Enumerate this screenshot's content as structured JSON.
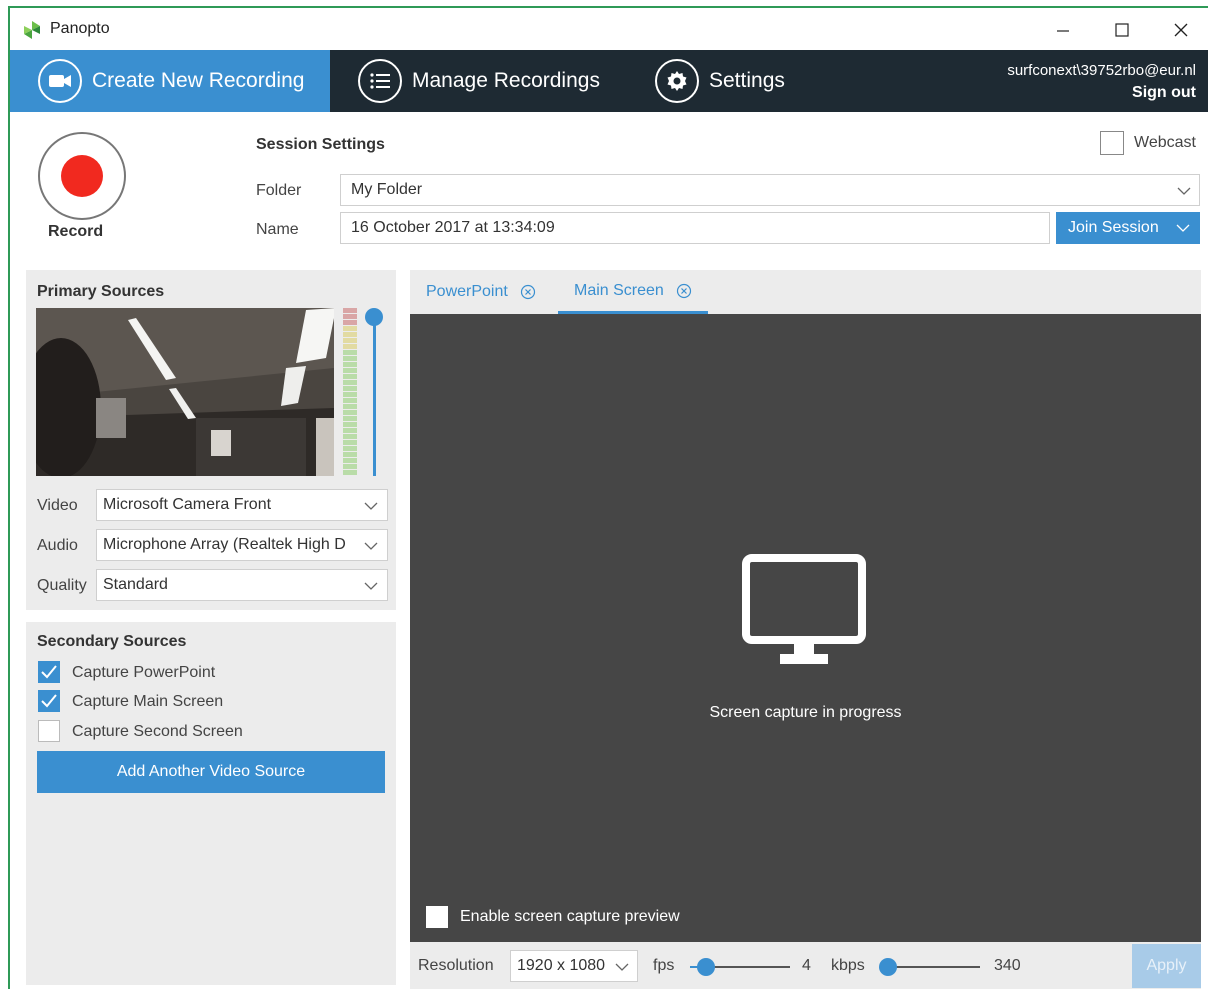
{
  "window": {
    "title": "Panopto",
    "minimize_icon": "minimize-icon",
    "maximize_icon": "maximize-icon",
    "close_icon": "close-icon"
  },
  "nav": {
    "tabs": [
      {
        "label": "Create New Recording",
        "icon": "camera-icon",
        "active": true
      },
      {
        "label": "Manage Recordings",
        "icon": "list-icon",
        "active": false
      },
      {
        "label": "Settings",
        "icon": "gear-icon",
        "active": false
      }
    ],
    "user_email": "surfconext\\39752rbo@eur.nl",
    "sign_out": "Sign out"
  },
  "record": {
    "label": "Record"
  },
  "session": {
    "title": "Session Settings",
    "webcast_label": "Webcast",
    "webcast_checked": false,
    "folder_label": "Folder",
    "folder_value": "My Folder",
    "name_label": "Name",
    "name_value": "16 October 2017 at 13:34:09",
    "join_label": "Join Session"
  },
  "primary": {
    "title": "Primary Sources",
    "video_label": "Video",
    "video_value": "Microsoft Camera Front",
    "audio_label": "Audio",
    "audio_value": "Microphone Array (Realtek High D",
    "quality_label": "Quality",
    "quality_value": "Standard"
  },
  "secondary": {
    "title": "Secondary Sources",
    "items": [
      {
        "label": "Capture PowerPoint",
        "checked": true
      },
      {
        "label": "Capture Main Screen",
        "checked": true
      },
      {
        "label": "Capture Second Screen",
        "checked": false
      }
    ],
    "add_button": "Add Another Video Source"
  },
  "preview": {
    "tabs": [
      {
        "label": "PowerPoint",
        "active": false
      },
      {
        "label": "Main Screen",
        "active": true
      }
    ],
    "status": "Screen capture in progress",
    "enable_label": "Enable screen capture preview",
    "enable_checked": false
  },
  "capture_settings": {
    "resolution_label": "Resolution",
    "resolution_value": "1920 x 1080",
    "fps_label": "fps",
    "fps_value": "4",
    "kbps_label": "kbps",
    "kbps_value": "340",
    "apply_label": "Apply"
  },
  "colors": {
    "accent": "#3a8fd0",
    "nav_bg": "#1e2a33",
    "record_red": "#f1291f",
    "window_border": "#2f9a57"
  }
}
